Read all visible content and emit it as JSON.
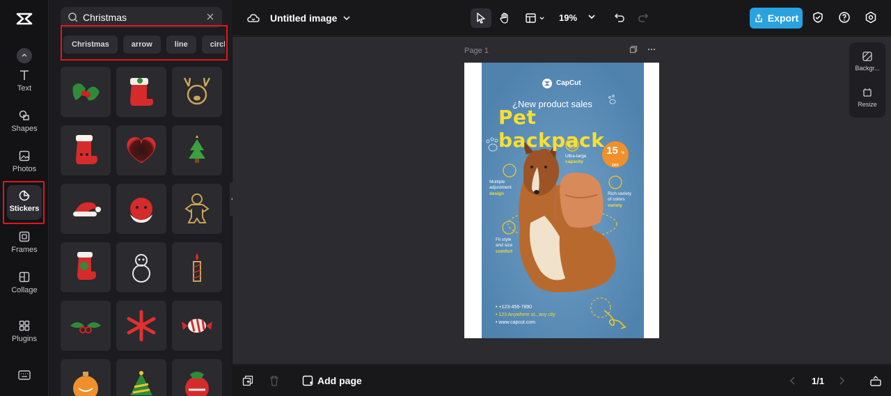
{
  "rail": {
    "items": [
      {
        "label": "Text"
      },
      {
        "label": "Shapes"
      },
      {
        "label": "Photos"
      },
      {
        "label": "Stickers"
      },
      {
        "label": "Frames"
      },
      {
        "label": "Collage"
      },
      {
        "label": "Plugins"
      }
    ]
  },
  "panel": {
    "search_value": "Christmas",
    "chips": [
      "Christmas",
      "arrow",
      "line",
      "circl"
    ]
  },
  "topbar": {
    "doc_title": "Untitled image",
    "zoom": "19%",
    "export_label": "Export"
  },
  "canvas": {
    "page_label": "Page 1",
    "side": {
      "background_label": "Backgr...",
      "resize_label": "Resize"
    }
  },
  "poster": {
    "brand": "CapCut",
    "headline_small": "¿New product sales",
    "headline": "Pet backpack",
    "badge_number": "15",
    "badge_sub": "% OFF",
    "f1_line1": "Ultra-large",
    "f1_line2": "capacity",
    "f2_line1": "Multiple",
    "f2_line2": "adjustment",
    "f2_line3": "design",
    "f3_line1": "Rich variety",
    "f3_line2": "of colors",
    "f3_line3": "variety",
    "f4_line1": "Fit style",
    "f4_line2": "and size",
    "f4_line3": "comfort",
    "contact1": "• +123-456-7890",
    "contact2": "• 123 Anywhere st., any city",
    "contact3": "• www.capcut.com"
  },
  "bottombar": {
    "add_page_label": "Add page",
    "pager": "1/1"
  }
}
